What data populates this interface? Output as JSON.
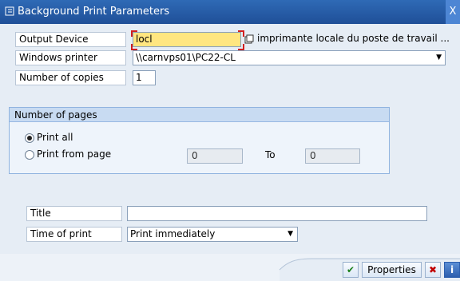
{
  "window": {
    "title": "Background Print Parameters",
    "close": "X"
  },
  "fields": {
    "output_device": {
      "label": "Output Device",
      "value": "locl",
      "description": "imprimante locale du poste de travail ..."
    },
    "windows_printer": {
      "label": "Windows printer",
      "value": "\\\\carnvps01\\PC22-CL"
    },
    "copies": {
      "label": "Number of copies",
      "value": "1"
    }
  },
  "pages": {
    "header": "Number of pages",
    "print_all": "Print all",
    "print_from": "Print from page",
    "from_value": "0",
    "to_label": "To",
    "to_value": "0"
  },
  "bottom": {
    "title_label": "Title",
    "title_value": "",
    "time_label": "Time of print",
    "time_value": "Print immediately"
  },
  "buttons": {
    "properties": "Properties"
  },
  "colors": {
    "titlebar": "#1f4f98",
    "focus_field": "#ffe680"
  }
}
